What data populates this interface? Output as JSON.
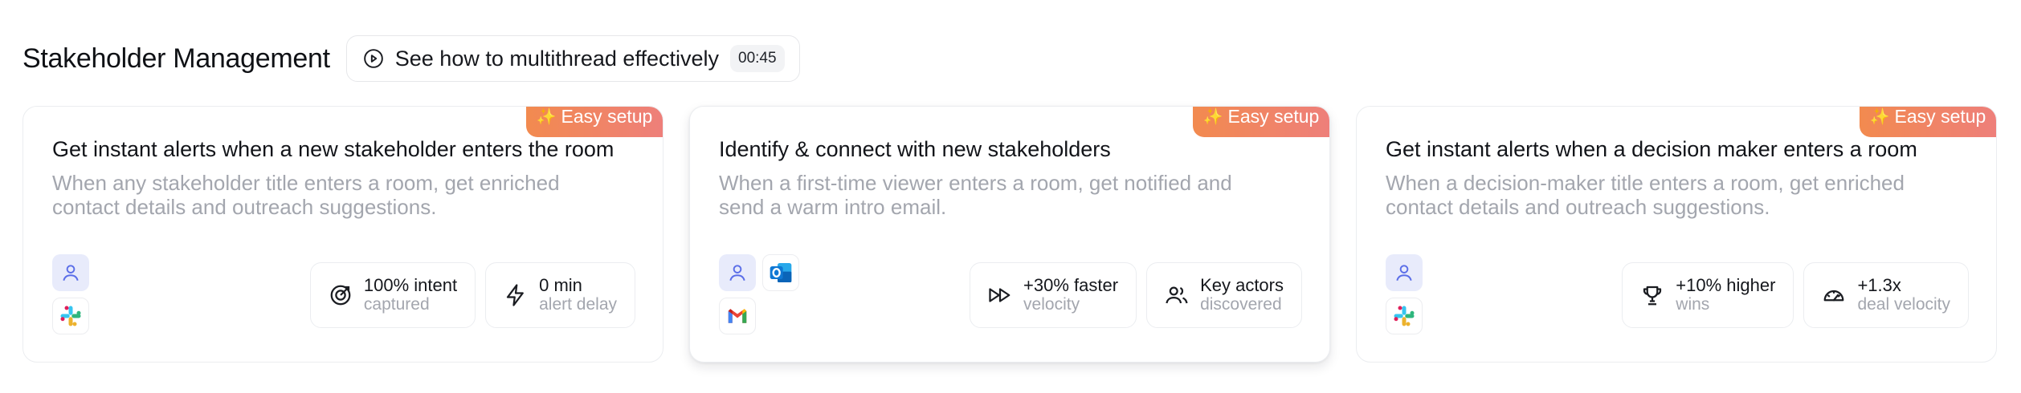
{
  "header": {
    "title": "Stakeholder Management",
    "video": {
      "label": "See how to multithread effectively",
      "duration": "00:45",
      "icon": "play-circle-icon"
    }
  },
  "cards": [
    {
      "badge": "Easy setup",
      "title": "Get instant alerts when a new stakeholder enters the room",
      "description": "When any stakeholder title enters a room, get enriched contact details and outreach suggestions.",
      "apps": [
        "user-icon",
        "slack-icon"
      ],
      "metrics": [
        {
          "icon": "target-icon",
          "top": "100% intent",
          "sub": "captured"
        },
        {
          "icon": "lightning-icon",
          "top": "0 min",
          "sub": "alert delay"
        }
      ]
    },
    {
      "badge": "Easy setup",
      "title": "Identify & connect with new stakeholders",
      "description": "When a first-time viewer enters a room, get notified and send a warm intro email.",
      "apps": [
        "user-icon",
        "outlook-icon",
        "gmail-icon"
      ],
      "metrics": [
        {
          "icon": "fast-forward-icon",
          "top": "+30% faster",
          "sub": "velocity"
        },
        {
          "icon": "users-icon",
          "top": "Key actors",
          "sub": "discovered"
        }
      ]
    },
    {
      "badge": "Easy setup",
      "title": "Get instant alerts when a decision maker enters a room",
      "description": "When a decision-maker title enters a room, get enriched contact details and outreach suggestions.",
      "apps": [
        "user-icon",
        "slack-icon"
      ],
      "metrics": [
        {
          "icon": "trophy-icon",
          "top": "+10% higher",
          "sub": "wins"
        },
        {
          "icon": "gauge-icon",
          "top": "+1.3x",
          "sub": "deal velocity"
        }
      ]
    }
  ],
  "colors": {
    "badge_start": "#f28a4f",
    "badge_end": "#ee7f7a",
    "muted_text": "#a3a6ae",
    "user_icon_bg": "#e8ebfb",
    "user_icon_stroke": "#5b6ee8"
  }
}
